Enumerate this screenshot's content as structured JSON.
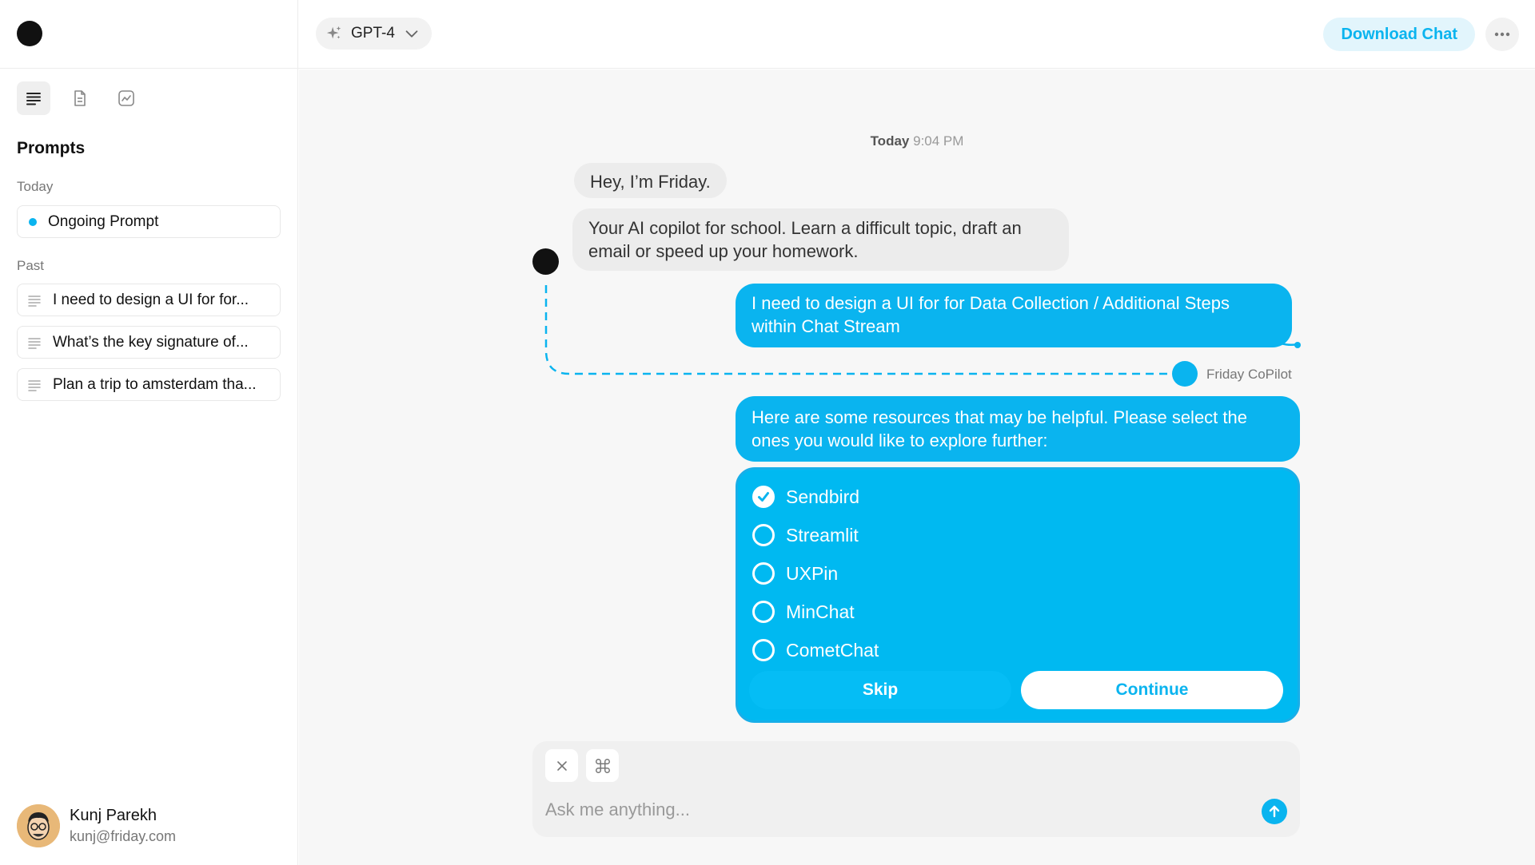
{
  "app": {
    "accent_color": "#0ab4ef"
  },
  "sidebar": {
    "logo": "logo-dot",
    "tabs": [
      {
        "icon": "list-icon",
        "active": true
      },
      {
        "icon": "document-icon",
        "active": false
      },
      {
        "icon": "chart-icon",
        "active": false
      }
    ],
    "title": "Prompts",
    "today_label": "Today",
    "ongoing": "Ongoing Prompt",
    "past_label": "Past",
    "past_items": [
      "I need to design a UI for for...",
      "What’s the key signature of...",
      "Plan a trip to amsterdam tha..."
    ],
    "user": {
      "name": "Kunj Parekh",
      "email": "kunj@friday.com"
    }
  },
  "topbar": {
    "model": "GPT-4",
    "download_label": "Download Chat",
    "more_icon": "more-horizontal-icon"
  },
  "chat": {
    "timestamp_day": "Today",
    "timestamp_time": "9:04 PM",
    "bot_greeting": "Hey, I’m Friday.",
    "bot_intro": "Your AI copilot for school. Learn a difficult topic, draft an email or speed up your homework.",
    "user_message": "I need to design a UI for for Data Collection / Additional Steps within Chat Stream",
    "copilot_label": "Friday CoPilot",
    "copilot_message": "Here are some resources that may be helpful. Please select the ones you would like to explore further:",
    "options": [
      {
        "label": "Sendbird",
        "checked": true
      },
      {
        "label": "Streamlit",
        "checked": false
      },
      {
        "label": "UXPin",
        "checked": false
      },
      {
        "label": "MinChat",
        "checked": false
      },
      {
        "label": "CometChat",
        "checked": false
      }
    ],
    "skip_label": "Skip",
    "continue_label": "Continue"
  },
  "composer": {
    "placeholder": "Ask me anything...",
    "tools": [
      "close-icon",
      "command-icon"
    ],
    "send_icon": "arrow-up-icon"
  }
}
